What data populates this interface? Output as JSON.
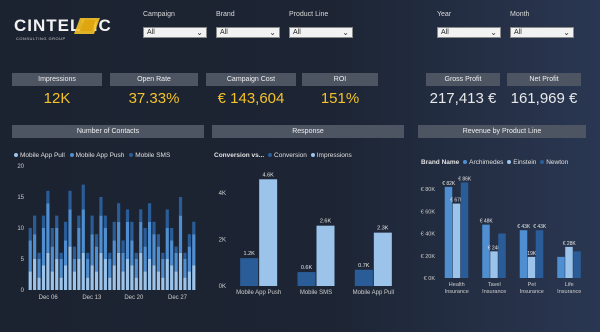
{
  "logo": {
    "name": "CINTELLIC",
    "tagline": "CONSULTING GROUP"
  },
  "filters": [
    {
      "label": "Campaign",
      "value": "All"
    },
    {
      "label": "Brand",
      "value": "All"
    },
    {
      "label": "Product Line",
      "value": "All"
    },
    {
      "label": "Year",
      "value": "All"
    },
    {
      "label": "Month",
      "value": "All"
    }
  ],
  "kpis": [
    {
      "label": "Impressions",
      "value": "12K"
    },
    {
      "label": "Open Rate",
      "value": "37.33%"
    },
    {
      "label": "Campaign Cost",
      "value": "€ 143,604"
    },
    {
      "label": "ROI",
      "value": "151%"
    },
    {
      "label": "Gross Profit",
      "value": "217,413 €"
    },
    {
      "label": "Net Profit",
      "value": "161,969 €"
    }
  ],
  "colors": {
    "yellow": "#f5c228",
    "dark_blue": "#2a5d97",
    "mid_blue": "#4f8fd1",
    "light_blue": "#9cc4ea"
  },
  "contacts_chart": {
    "title": "Number of  Contacts",
    "legend": [
      "Mobile App Pull",
      "Mobile App Push",
      "Mobile SMS"
    ],
    "chart_data": {
      "type": "bar",
      "stacked": true,
      "ylim": [
        0,
        20
      ],
      "yticks": [
        "0",
        "5",
        "10",
        "15",
        "20"
      ],
      "xticks": [
        "Dec 06",
        "Dec 13",
        "Dec 20",
        "Dec 27"
      ],
      "series": [
        {
          "name": "Mobile App Pull",
          "values": [
            3,
            5,
            2,
            4,
            6,
            3,
            5,
            2,
            4,
            7,
            3,
            5,
            6,
            2,
            4,
            3,
            6,
            5,
            2,
            4,
            6,
            3,
            5,
            4,
            2,
            6,
            3,
            5,
            4,
            3,
            2,
            5,
            4,
            3,
            6,
            2,
            3,
            4
          ]
        },
        {
          "name": "Mobile App Push",
          "values": [
            5,
            4,
            3,
            6,
            8,
            4,
            5,
            3,
            4,
            6,
            2,
            5,
            7,
            3,
            5,
            4,
            6,
            5,
            3,
            4,
            5,
            3,
            6,
            4,
            3,
            5,
            4,
            6,
            5,
            4,
            3,
            5,
            4,
            3,
            6,
            3,
            4,
            5
          ]
        },
        {
          "name": "Mobile SMS",
          "values": [
            2,
            3,
            1,
            2,
            2,
            3,
            2,
            1,
            3,
            3,
            2,
            2,
            4,
            1,
            3,
            2,
            3,
            2,
            1,
            3,
            3,
            2,
            2,
            3,
            1,
            2,
            3,
            3,
            2,
            2,
            1,
            3,
            2,
            1,
            3,
            1,
            2,
            2
          ]
        }
      ]
    }
  },
  "response_chart": {
    "title": "Response",
    "legend_title": "Conversion vs...",
    "legend": [
      "Conversion",
      "Impressions"
    ],
    "chart_data": {
      "type": "bar",
      "categories": [
        "Mobile App Push",
        "Mobile SMS",
        "Mobile App Pull"
      ],
      "ylim": [
        0,
        5000
      ],
      "yticks": [
        "0K",
        "2K",
        "4K"
      ],
      "series": [
        {
          "name": "Conversion",
          "values": [
            1200,
            600,
            700
          ],
          "labels": [
            "1.2K",
            "0.6K",
            "0.7K"
          ]
        },
        {
          "name": "Impressions",
          "values": [
            4600,
            2600,
            2300
          ],
          "labels": [
            "4.6K",
            "2.6K",
            "2.3K"
          ]
        }
      ]
    }
  },
  "revenue_chart": {
    "title": "Revenue by Product Line",
    "legend_title": "Brand Name",
    "legend": [
      "Archimedes",
      "Einstein",
      "Newton"
    ],
    "chart_data": {
      "type": "bar",
      "categories": [
        "Health Insurance",
        "Tavel Insurance",
        "Pet Insurance",
        "Life Insurance"
      ],
      "ylim": [
        0,
        90000
      ],
      "yticks": [
        "€ 0K",
        "€ 20K",
        "€ 40K",
        "€ 60K",
        "€ 80K"
      ],
      "series": [
        {
          "name": "Archimedes",
          "values": [
            82000,
            48000,
            43000,
            19000
          ],
          "labels": [
            "€ 82K",
            "€ 48K",
            "€ 43K",
            ""
          ]
        },
        {
          "name": "Einstein",
          "values": [
            67000,
            24000,
            19000,
            28000
          ],
          "labels": [
            "€ 67K",
            "€ 24K",
            "19K",
            "€ 28K"
          ]
        },
        {
          "name": "Newton",
          "values": [
            86000,
            40000,
            43000,
            24000
          ],
          "labels": [
            "€ 86K",
            "",
            "€ 43K",
            ""
          ]
        }
      ]
    }
  }
}
